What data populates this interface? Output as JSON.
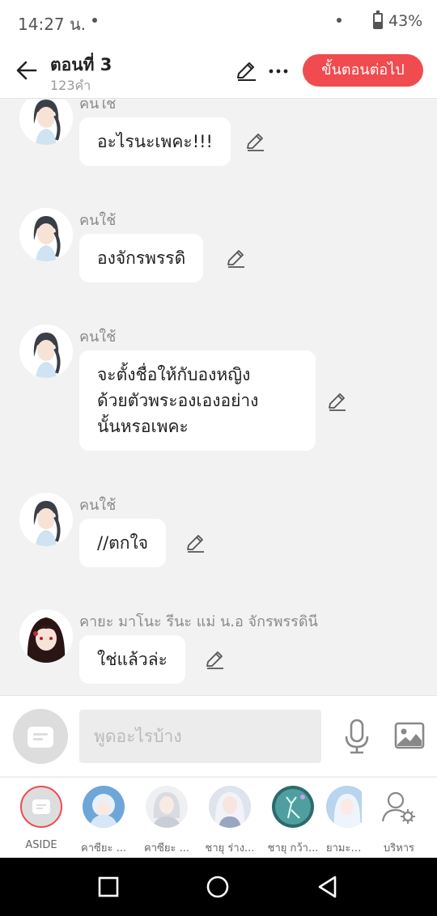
{
  "status_bar": {
    "time": "14:27 น.",
    "battery": "43%"
  },
  "header": {
    "title": "ตอนที่ 3",
    "word_count": "123คำ",
    "next_label": "ขั้นตอนต่อไป"
  },
  "messages": [
    {
      "sender": "คนใช้",
      "lines": [
        "อะไรนะเพคะ!!!"
      ]
    },
    {
      "sender": "คนใช้",
      "lines": [
        "องจักรพรรดิ"
      ]
    },
    {
      "sender": "คนใช้",
      "lines": [
        "จะตั้งชื่อให้กับองหญิง",
        "ด้วยตัวพระองเองอย่าง",
        "นั้นหรอเพคะ"
      ]
    },
    {
      "sender": "คนใช้",
      "lines": [
        "//ตกใจ"
      ]
    },
    {
      "sender": "คายะ มาโนะ รีนะ แม่ น.อ จักรพรรดินี",
      "lines": [
        "ใช่แล้วล่ะ"
      ]
    }
  ],
  "input": {
    "placeholder": "พูดอะไรบ้าง"
  },
  "characters": [
    {
      "label": "ASIDE"
    },
    {
      "label": "คาซียะ ..."
    },
    {
      "label": "คาซียะ ..."
    },
    {
      "label": "ชายุ ร่าง..."
    },
    {
      "label": "ชายุ กว้า..."
    },
    {
      "label": "ยามะ ชุ..."
    }
  ],
  "manage_label": "บริหาร",
  "colors": {
    "accent": "#f04b4f",
    "background": "#f2f2f2"
  }
}
